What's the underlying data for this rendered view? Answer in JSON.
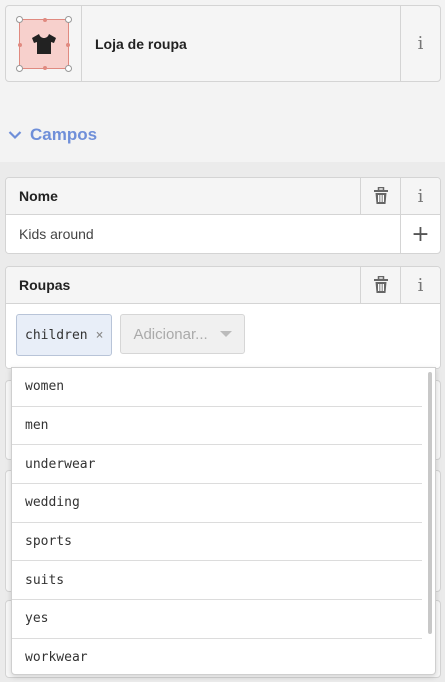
{
  "preset": {
    "name": "Loja de roupa",
    "icon": "shirt-icon"
  },
  "section": {
    "title": "Campos"
  },
  "fields": [
    {
      "label": "Nome",
      "value": "Kids around"
    },
    {
      "label": "Roupas",
      "chips": [
        "children"
      ],
      "add_placeholder": "Adicionar..."
    }
  ],
  "dropdown": {
    "options": [
      "women",
      "men",
      "underwear",
      "wedding",
      "sports",
      "suits",
      "yes",
      "workwear"
    ]
  },
  "glyphs": {
    "info": "i",
    "plus": "+",
    "remove": "×"
  },
  "colors": {
    "accent": "#6f8fd9",
    "icon_fill": "#f7d0cc",
    "chip_bg": "#e8eef8"
  }
}
